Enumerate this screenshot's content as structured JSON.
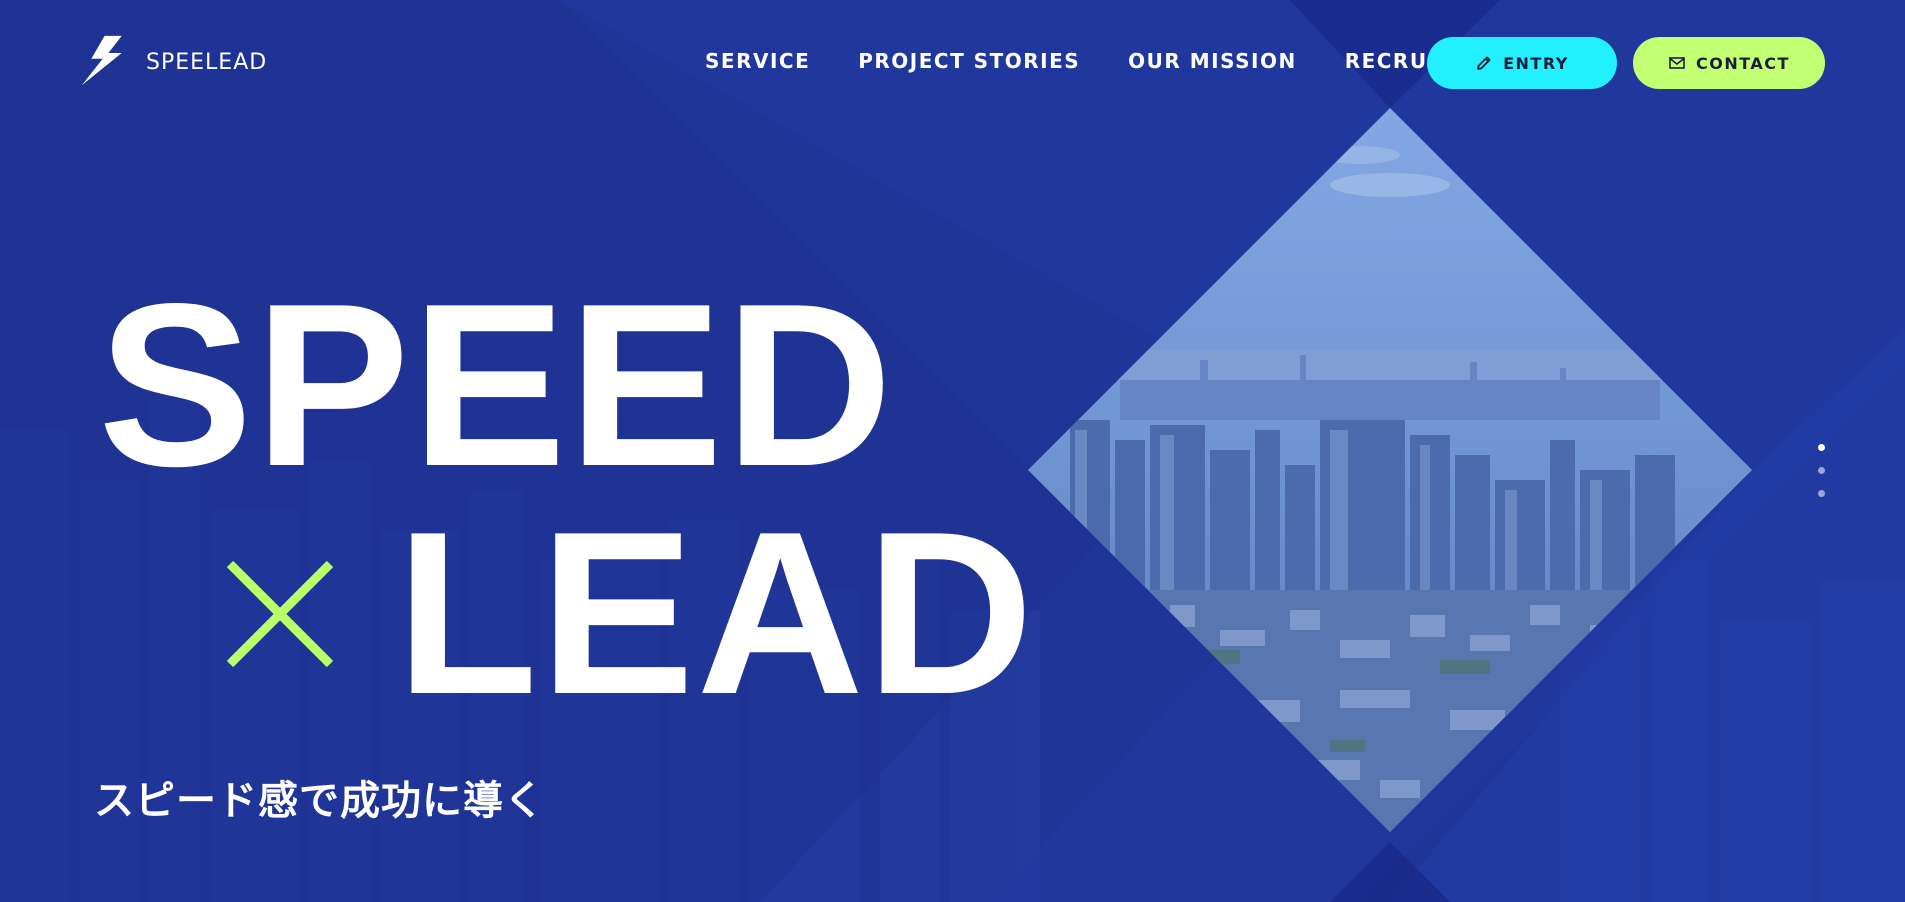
{
  "header": {
    "logo_text": "SPEELEAD",
    "nav": [
      {
        "label": "SERVICE"
      },
      {
        "label": "PROJECT STORIES"
      },
      {
        "label": "OUR MISSION"
      },
      {
        "label": "RECRUIT"
      }
    ],
    "entry_label": "ENTRY",
    "contact_label": "CONTACT"
  },
  "hero": {
    "headline_word1": "SPEED",
    "headline_word2": "LEAD",
    "subcopy": "スピード感で成功に導く",
    "slides": [
      {
        "active": true
      },
      {
        "active": false
      },
      {
        "active": false
      }
    ]
  },
  "colors": {
    "background": "#1f3598",
    "entry_button": "#22f0ff",
    "contact_button": "#c3ff72",
    "cross_accent": "#b8ff6a",
    "text": "#ffffff"
  },
  "icons": {
    "logo": "lightning-bolt-logo",
    "entry": "pencil-icon",
    "contact": "envelope-icon",
    "cross": "multiply-cross-icon"
  }
}
